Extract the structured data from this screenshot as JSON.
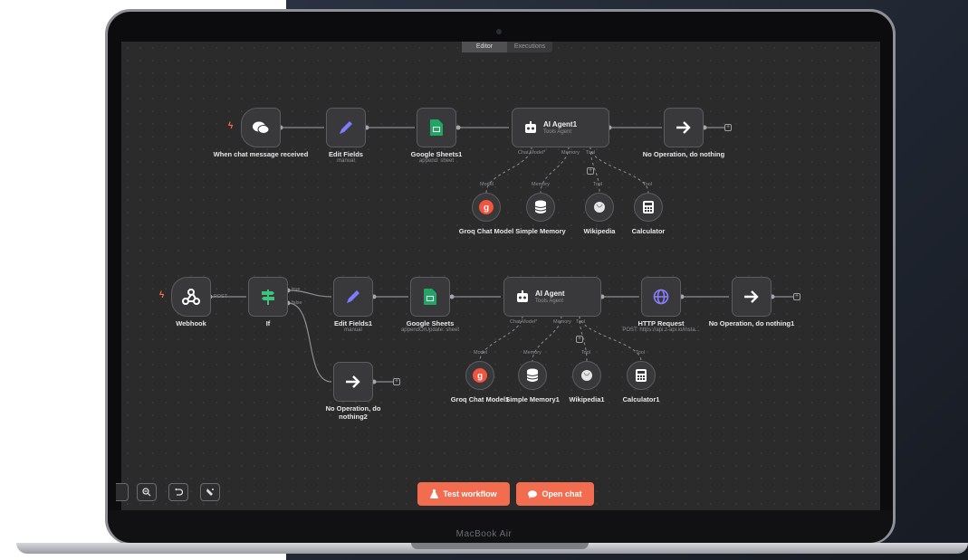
{
  "canvas_tabs": [
    "Editor",
    "Executions"
  ],
  "brand": "MacBook Air",
  "workflow1": {
    "chat_trigger": {
      "label": "When chat message received"
    },
    "edit_fields": {
      "label": "Edit Fields",
      "sub": "manual"
    },
    "sheets": {
      "label": "Google Sheets1",
      "sub": "append: sheet"
    },
    "agent": {
      "title": "AI Agent1",
      "sub": "Tools Agent",
      "port_model": "Chat Model*",
      "port_memory": "Memory",
      "port_tool": "Tool"
    },
    "noop": {
      "label": "No Operation, do nothing"
    },
    "groq": {
      "label": "Groq Chat Model",
      "port": "Model"
    },
    "memory": {
      "label": "Simple Memory",
      "port": "Memory"
    },
    "wiki": {
      "label": "Wikipedia",
      "port": "Tool"
    },
    "calc": {
      "label": "Calculator",
      "port": "Tool"
    }
  },
  "workflow2": {
    "webhook": {
      "label": "Webhook",
      "edge": "POST"
    },
    "if": {
      "label": "If",
      "true": "true",
      "false": "false"
    },
    "edit_fields": {
      "label": "Edit Fields1",
      "sub": "manual"
    },
    "sheets": {
      "label": "Google Sheets",
      "sub": "appendOrUpdate: sheet"
    },
    "agent": {
      "title": "AI Agent",
      "sub": "Tools Agent",
      "port_model": "Chat Model*",
      "port_memory": "Memory",
      "port_tool": "Tool"
    },
    "http": {
      "label": "HTTP Request",
      "sub": "POST: https://api.z-api.io/insta..."
    },
    "noop1": {
      "label": "No Operation, do nothing1"
    },
    "noop2": {
      "label": "No Operation, do nothing2"
    },
    "groq": {
      "label": "Groq Chat Model1",
      "port": "Model"
    },
    "memory": {
      "label": "Simple Memory1",
      "port": "Memory"
    },
    "wiki": {
      "label": "Wikipedia1",
      "port": "Tool"
    },
    "calc": {
      "label": "Calculator1",
      "port": "Tool"
    }
  },
  "toolbar": {
    "icons": [
      "zoom-out-icon",
      "undo-icon",
      "eraser-icon"
    ]
  },
  "actions": {
    "test_workflow": "Test workflow",
    "open_chat": "Open chat"
  },
  "colors": {
    "accent": "#f26c4f",
    "canvas": "#2b2b2c",
    "node": "#39393b"
  }
}
